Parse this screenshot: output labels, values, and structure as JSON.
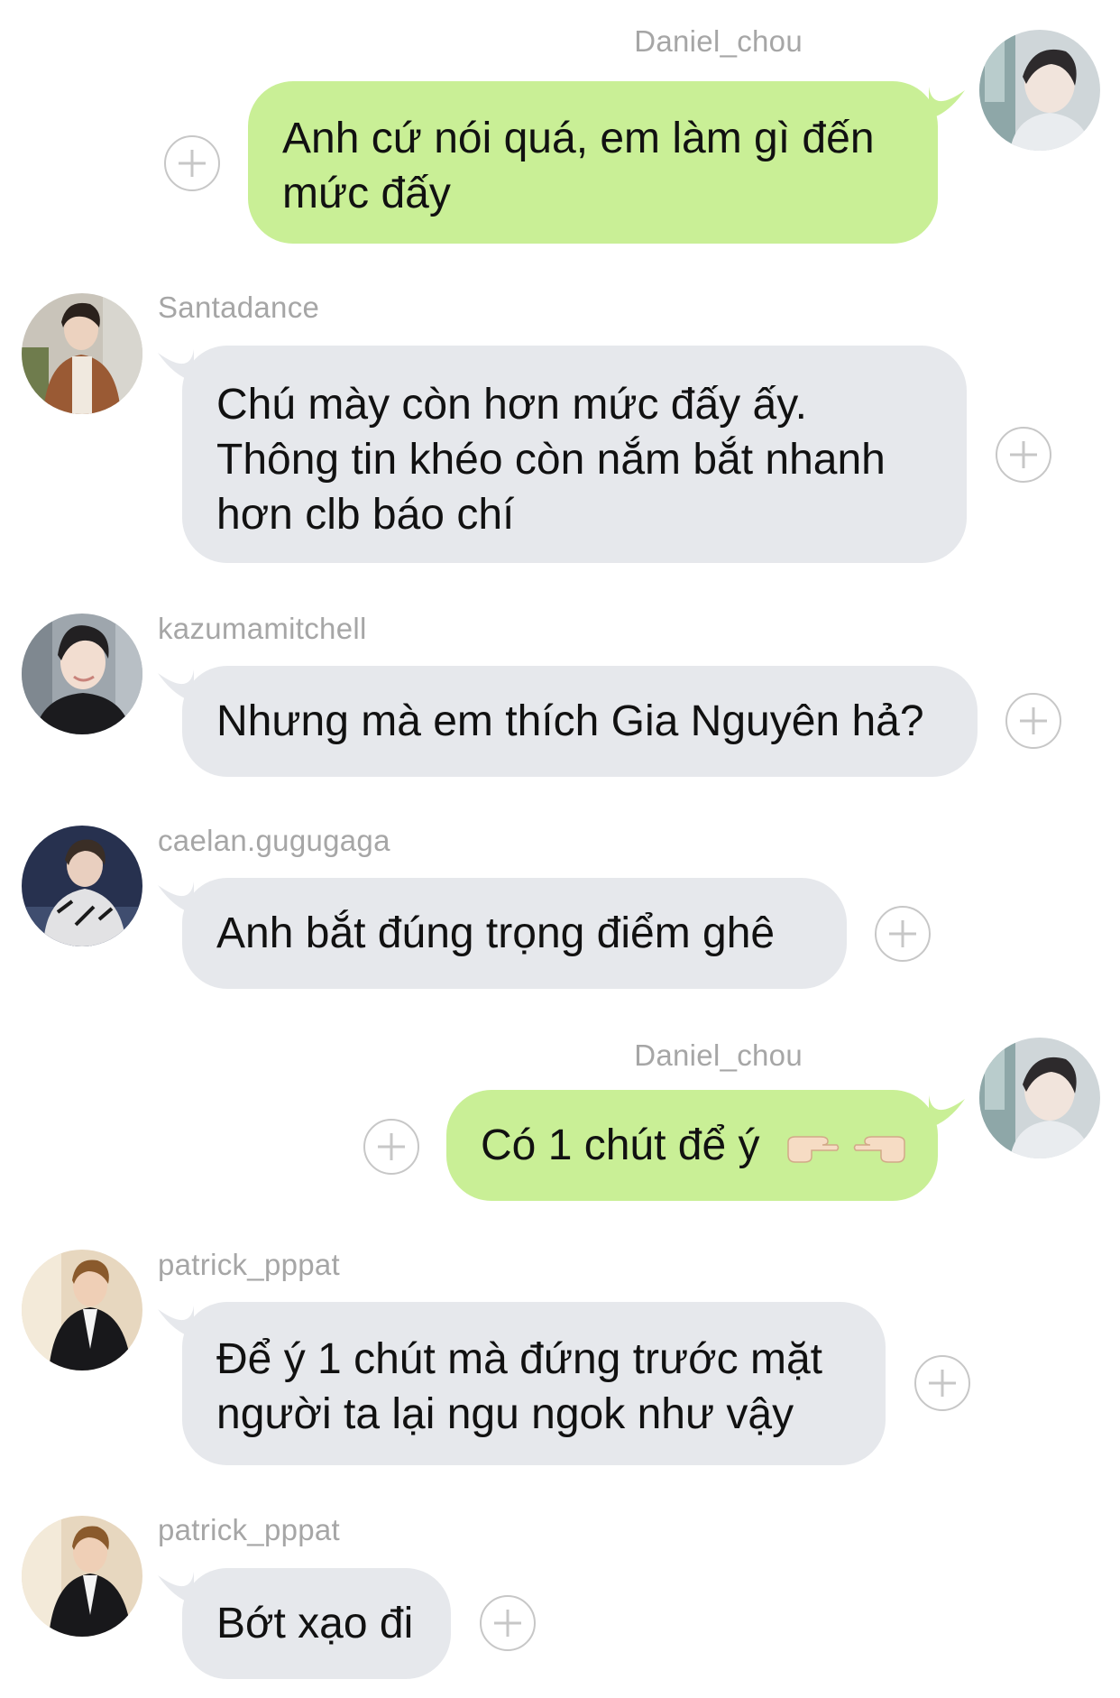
{
  "messages": [
    {
      "sender": "Daniel_chou",
      "direction": "outgoing",
      "lines": [
        "Anh cứ nói quá, em làm gì đến",
        "mức đấy"
      ]
    },
    {
      "sender": "Santadance",
      "direction": "incoming",
      "lines": [
        "Chú mày còn hơn mức đấy ấy.",
        "Thông tin khéo còn nắm bắt nhanh",
        "hơn clb báo chí"
      ]
    },
    {
      "sender": "kazumamitchell",
      "direction": "incoming",
      "lines": [
        "Nhưng mà em thích Gia Nguyên hả?"
      ]
    },
    {
      "sender": "caelan.gugugaga",
      "direction": "incoming",
      "lines": [
        "Anh bắt đúng trọng điểm ghê"
      ]
    },
    {
      "sender": "Daniel_chou",
      "direction": "outgoing",
      "lines": [
        "Có 1 chút để ý"
      ],
      "emoji": [
        "backhand-index-pointing-right",
        "backhand-index-pointing-left"
      ]
    },
    {
      "sender": "patrick_pppat",
      "direction": "incoming",
      "lines": [
        "Để ý 1 chút mà đứng trước mặt",
        "người ta lại ngu ngok như vậy"
      ]
    },
    {
      "sender": "patrick_pppat",
      "direction": "incoming",
      "lines": [
        "Bớt xạo đi"
      ]
    }
  ],
  "colors": {
    "incoming_bubble": "#e6e8ec",
    "outgoing_bubble": "#c9ef96",
    "sender_name": "#a6a6a6",
    "add_icon": "#c7c7c7",
    "background": "#ffffff"
  },
  "icons": {
    "add": "plus-circle-icon",
    "avatar": "avatar-photo"
  }
}
